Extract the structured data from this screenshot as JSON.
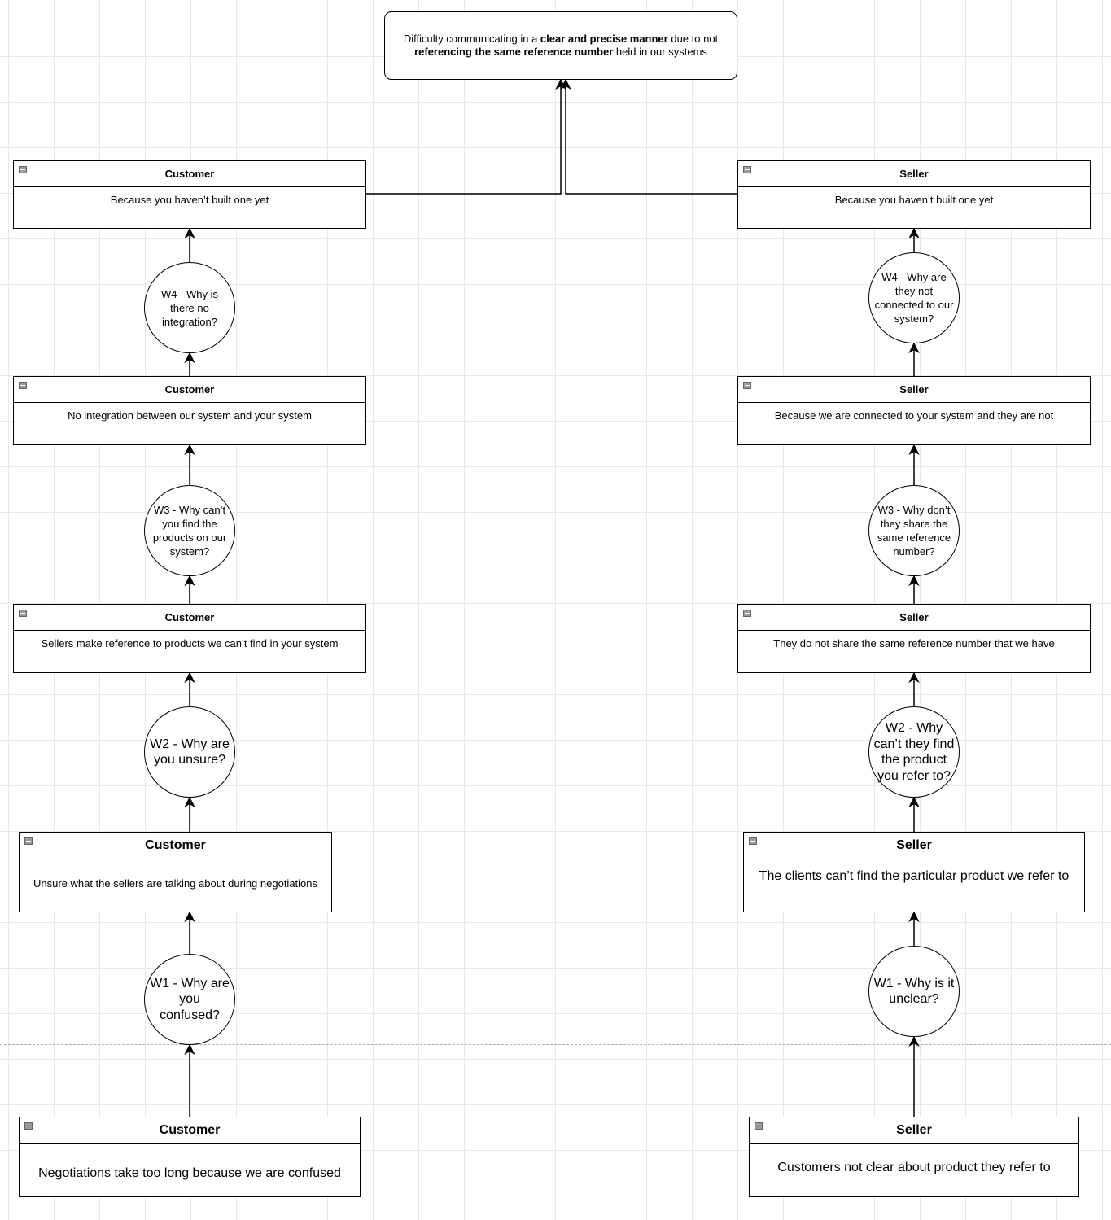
{
  "root": {
    "parts": [
      {
        "text": "Difficulty communicating in a ",
        "bold": false
      },
      {
        "text": "clear and precise manner",
        "bold": true
      },
      {
        "text": " due to not ",
        "bold": false
      },
      {
        "text": "referencing the same reference number",
        "bold": true
      },
      {
        "text": " held in our systems",
        "bold": false
      }
    ]
  },
  "customer": {
    "boxes": [
      {
        "title": "Customer",
        "body": "Because you haven’t built one yet"
      },
      {
        "title": "Customer",
        "body": "No integration between our system and your system"
      },
      {
        "title": "Customer",
        "body": "Sellers make reference to products we can’t find in your system"
      },
      {
        "title": "Customer",
        "body": "Unsure what the sellers are talking about during negotiations"
      },
      {
        "title": "Customer",
        "body": "Negotiations take too long because we are confused"
      }
    ],
    "whys": [
      "W4 - Why is\nthere no\nintegration?",
      "W3 - Why can’t\nyou find the\nproducts on our\nsystem?",
      "W2 - Why are\nyou unsure?",
      "W1 - Why are\nyou\nconfused?"
    ]
  },
  "seller": {
    "boxes": [
      {
        "title": "Seller",
        "body": "Because you haven’t built one yet"
      },
      {
        "title": "Seller",
        "body": "Because we are connected to your system and they are not"
      },
      {
        "title": "Seller",
        "body": "They do not share the same reference number that we have"
      },
      {
        "title": "Seller",
        "body": "The clients can’t find the particular product we refer to"
      },
      {
        "title": "Seller",
        "body": "Customers not clear about product they refer to"
      }
    ],
    "whys": [
      "W4 - Why are\nthey not\nconnected to our\nsystem?",
      "W3 - Why don’t\nthey share the\nsame reference\nnumber?",
      "W2 - Why\ncan’t they find\nthe product\nyou refer to?",
      "W1 - Why is it\nunclear?"
    ]
  }
}
